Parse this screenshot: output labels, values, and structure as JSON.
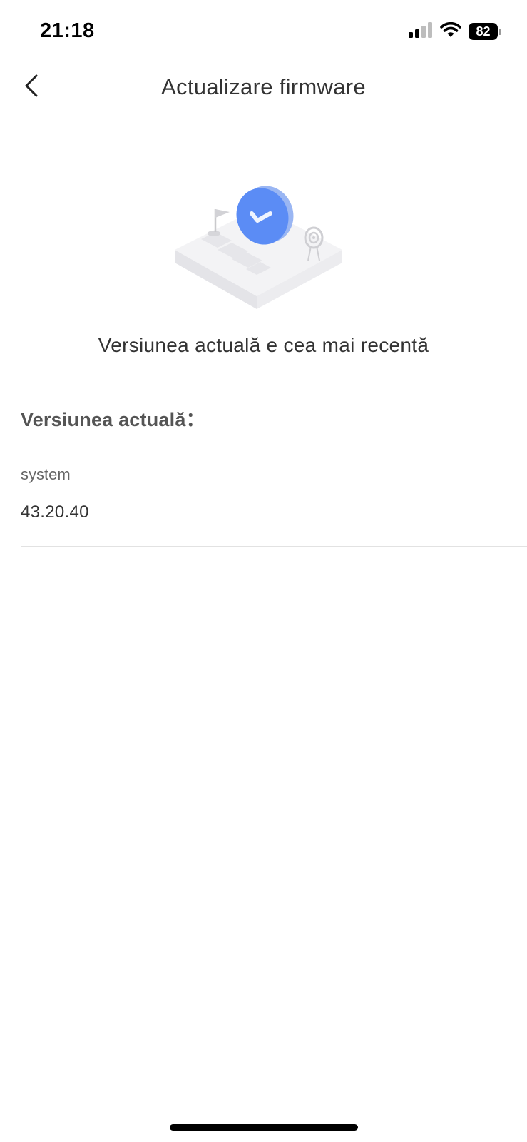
{
  "status_bar": {
    "time": "21:18",
    "battery_level": "82",
    "signal_icon": "cellular-signal-icon",
    "wifi_icon": "wifi-icon"
  },
  "header": {
    "title": "Actualizare firmware",
    "back_icon": "chevron-left-icon"
  },
  "hero": {
    "illustration": "firmware-up-to-date-illustration",
    "message": "Versiunea actuală e cea mai recentă"
  },
  "current_version": {
    "section_title": "Versiunea actuală：",
    "items": [
      {
        "label": "system",
        "value": "43.20.40"
      }
    ]
  },
  "colors": {
    "accent": "#5b8cf5",
    "text_primary": "#333333",
    "text_secondary": "#666666",
    "divider": "#e2e2e2"
  }
}
